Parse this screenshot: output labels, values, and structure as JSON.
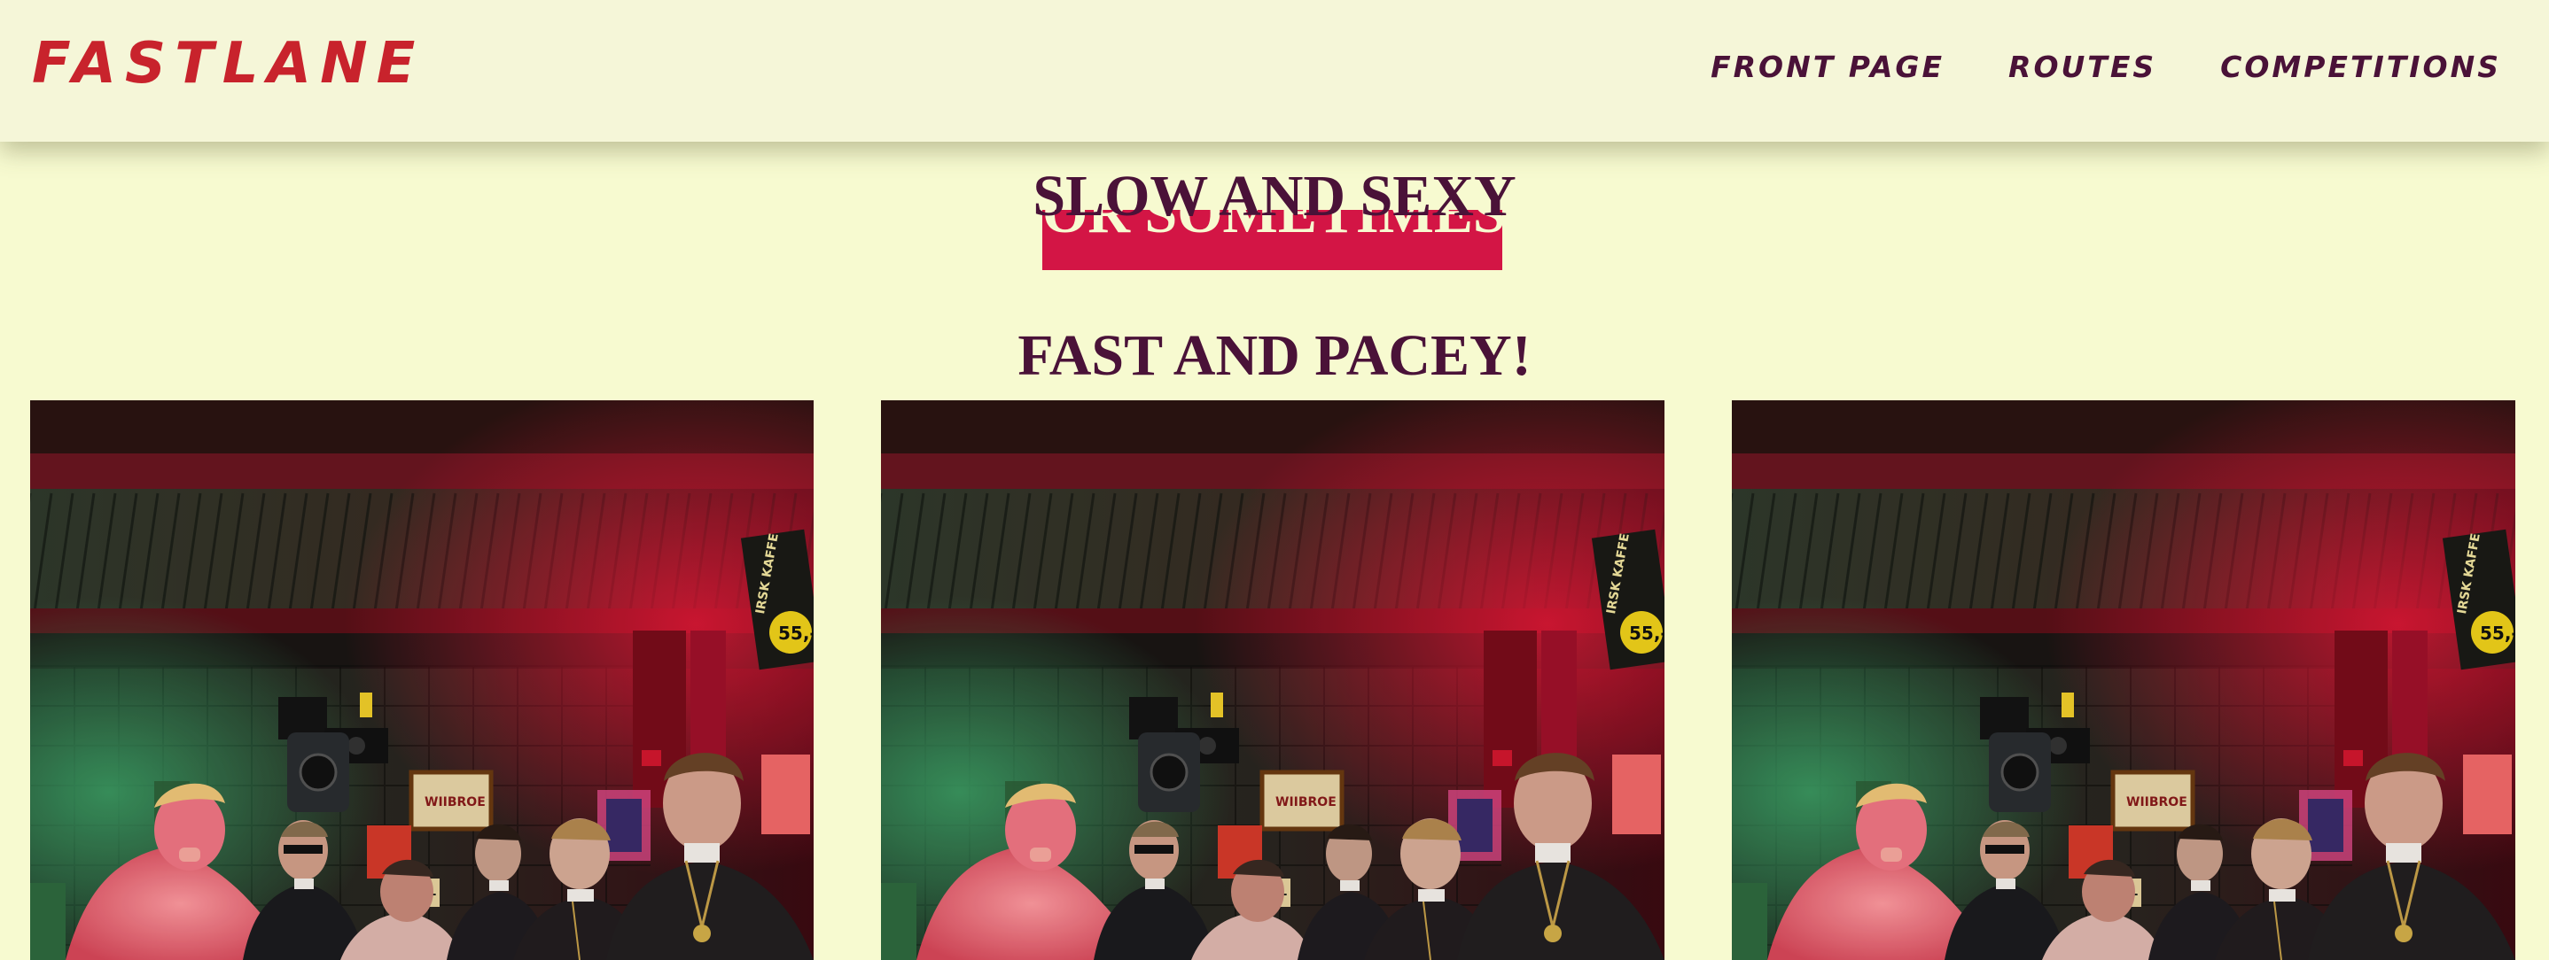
{
  "brand": {
    "name": "FASTLANE",
    "color": "#c8232c"
  },
  "nav": {
    "items": [
      {
        "label": "FRONT PAGE"
      },
      {
        "label": "ROUTES"
      },
      {
        "label": "COMPETITIONS"
      }
    ]
  },
  "hero": {
    "line1": "SLOW AND SEXY",
    "line2": "OR SOMETIMES",
    "line3": "FAST AND PACEY!",
    "accent_color": "#d31545",
    "text_color": "#4a1238"
  },
  "gallery": {
    "sign_text": "IRSK KAFFE",
    "sign_price": "55,-",
    "poster_text": "WIIBROE",
    "small_price": "55,-",
    "photos": [
      {
        "icon": "group-photo-bar-interior"
      },
      {
        "icon": "group-photo-bar-interior"
      },
      {
        "icon": "group-photo-bar-interior"
      }
    ]
  },
  "theme": {
    "background": "#f7fad0",
    "navbar_background": "#f5f6d8"
  }
}
